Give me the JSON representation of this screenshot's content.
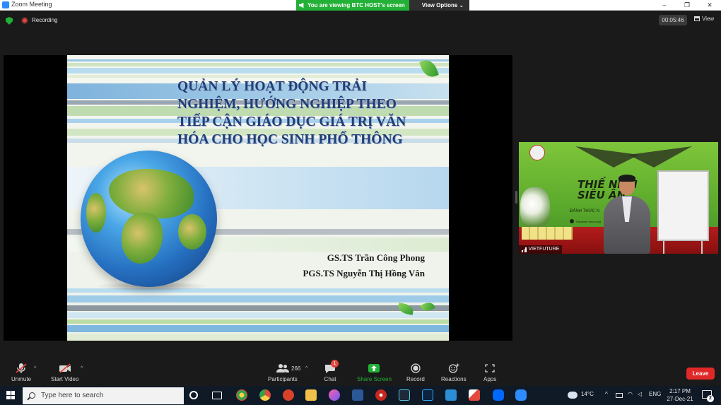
{
  "window": {
    "title": "Zoom Meeting",
    "controls": [
      "–",
      "❐",
      "✕"
    ]
  },
  "banner": {
    "viewing_text": "You are viewing BTC HOST's screen",
    "view_options": "View Options ⌄"
  },
  "topbar": {
    "recording": "Recording",
    "timer": "00:05:46",
    "view": "View"
  },
  "slide": {
    "title_lines": [
      "QUẢN LÝ HOẠT ĐỘNG TRẢI",
      "NGHIỆM, HƯỚNG NGHIỆP THEO",
      "TIẾP CẬN GIÁO DỤC GIÁ TRỊ VĂN",
      "HÓA CHO HỌC SINH PHỔ THÔNG"
    ],
    "authors": [
      "GS.TS Trần Công Phong",
      "PGS.TS Nguyễn Thị Hồng Vân"
    ]
  },
  "video": {
    "participant_name": "VIETFUTURE",
    "sign_line1": "THIẾ  NIÊN",
    "sign_line2": "SIÊU  ÂN",
    "sub": "ĐÁNH THỨC N",
    "fb": "Thieunien sieu nang"
  },
  "toolbar": {
    "unmute": "Unmute",
    "start_video": "Start Video",
    "participants": "Participants",
    "participant_count": "266",
    "chat": "Chat",
    "chat_badge": "1",
    "share_screen": "Share Screen",
    "record": "Record",
    "reactions": "Reactions",
    "apps": "Apps",
    "leave": "Leave",
    "accent_green": "#23b036",
    "leave_color": "#e02828"
  },
  "taskbar": {
    "search_placeholder": "Type here to search",
    "weather": "14°C",
    "language": "ENG",
    "time": "2:17 PM",
    "date": "27-Dec-21",
    "notifications": "2"
  }
}
